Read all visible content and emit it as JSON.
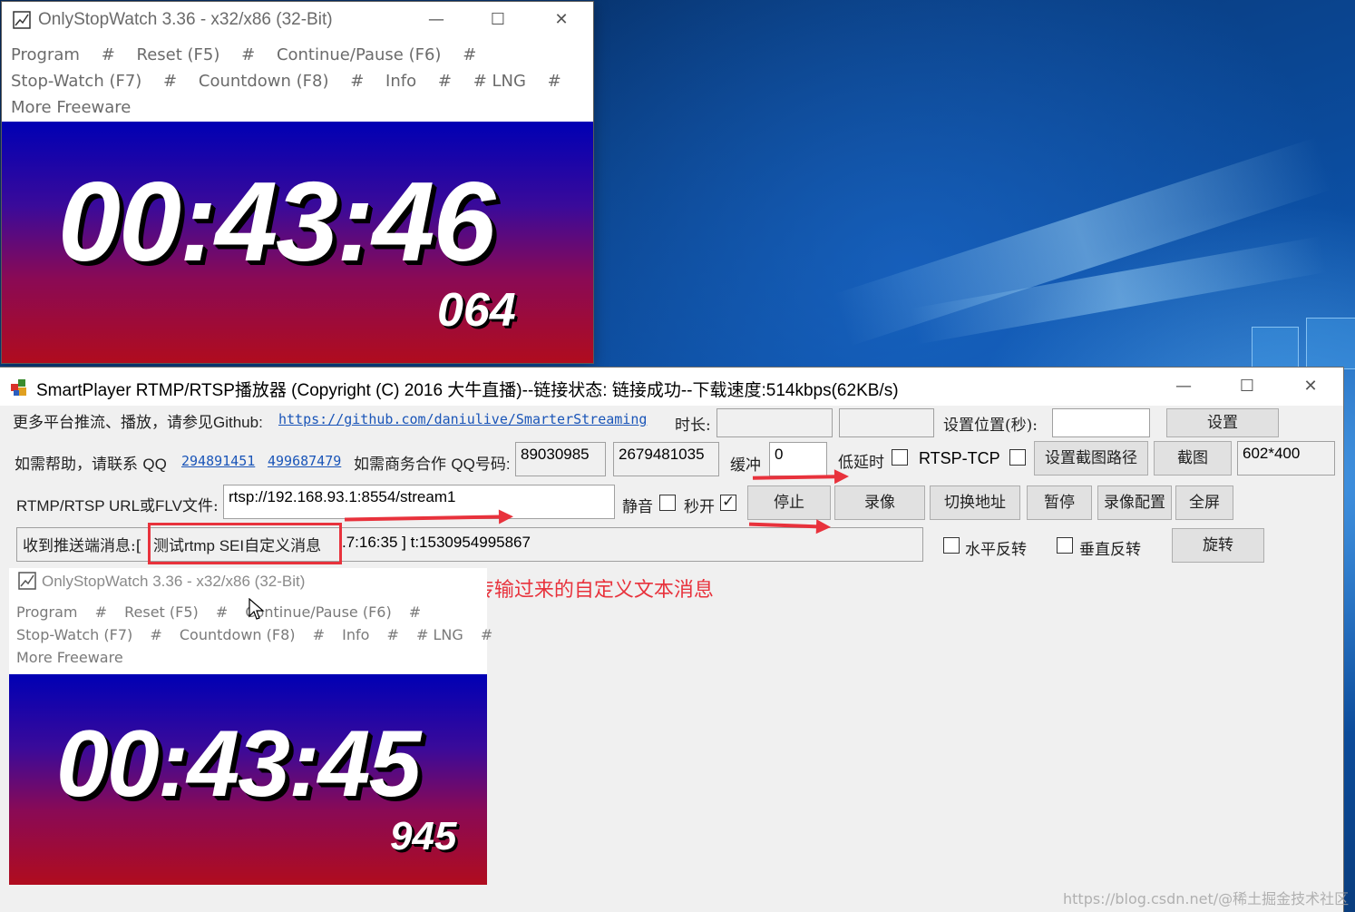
{
  "stopwatch_top": {
    "title": "OnlyStopWatch 3.36 - x32/x86 (32-Bit)",
    "menu_row1": [
      "Program",
      "#",
      "Reset (F5)",
      "#",
      "Continue/Pause (F6)",
      "#"
    ],
    "menu_row2": [
      "Stop-Watch (F7)",
      "#",
      "Countdown (F8)",
      "#",
      "Info",
      "#",
      "# LNG",
      "#"
    ],
    "menu_row3": [
      "More Freeware"
    ],
    "time": "00:43:46",
    "ms": "064"
  },
  "player": {
    "title": "SmartPlayer RTMP/RTSP播放器 (Copyright (C) 2016 大牛直播)--链接状态: 链接成功--下载速度:514kbps(62KB/s)",
    "row1": {
      "intro": "更多平台推流、播放，请参见",
      "github_label": "Github:",
      "github_url": "https://github.com/daniulive/SmarterStreaming",
      "duration_label": "时长:",
      "duration_value": "",
      "duration_value2": "",
      "seek_label": "设置位置(秒):",
      "seek_value": "",
      "set_button": "设置"
    },
    "row2": {
      "help_label": "如需帮助，请联系",
      "qq_label": "QQ",
      "qq1": "294891451",
      "qq2": "499687479",
      "biz_label": "如需商务合作",
      "biz_qq_label": "QQ号码:",
      "biz_qq1": "89030985",
      "biz_qq2": "2679481035",
      "buffer_label": "缓冲",
      "buffer_value": "0",
      "low_latency_label": "低延时",
      "low_latency_checked": false,
      "rtsp_tcp_label": "RTSP-TCP",
      "rtsp_tcp_checked": false,
      "snapshot_path_button": "设置截图路径",
      "snapshot_button": "截图",
      "resolution": "602*400"
    },
    "row3": {
      "url_label_a": "RTMP/RTSP URL",
      "url_label_b": "或",
      "url_label_c": "FLV",
      "url_label_d": "文件:",
      "url_value": "rtsp://192.168.93.1:8554/stream1",
      "mute_label": "静音",
      "mute_checked": false,
      "fast_open_label": "秒开",
      "fast_open_checked": true,
      "stop_button": "停止",
      "record_button": "录像",
      "switch_url_button": "切换地址",
      "pause_button": "暂停",
      "record_config_button": "录像配置",
      "fullscreen_button": "全屏"
    },
    "row4": {
      "msg_label": "收到推送端消息:[",
      "msg_sei_a": "测试",
      "msg_sei_b": "rtmp SEI",
      "msg_sei_c": "自定义消息",
      "msg_rest": ".7:16:35 ] t:1530954995867",
      "hflip_label": "水平反转",
      "hflip_checked": false,
      "vflip_label": "垂直反转",
      "vflip_checked": false,
      "rotate_button": "旋转"
    },
    "annotation": "通过SEI方式传输过来的自定义文本消息"
  },
  "stopwatch_embedded": {
    "title": "OnlyStopWatch 3.36 - x32/x86 (32-Bit)",
    "menu_row1": [
      "Program",
      "#",
      "Reset (F5)",
      "#",
      "Continue/Pause (F6)",
      "#"
    ],
    "menu_row2": [
      "Stop-Watch (F7)",
      "#",
      "Countdown (F8)",
      "#",
      "Info",
      "#",
      "# LNG",
      "#"
    ],
    "menu_row3": [
      "More Freeware"
    ],
    "time": "00:43:45",
    "ms": "945"
  },
  "watermark": "https://blog.csdn.net/@稀土掘金技术社区"
}
